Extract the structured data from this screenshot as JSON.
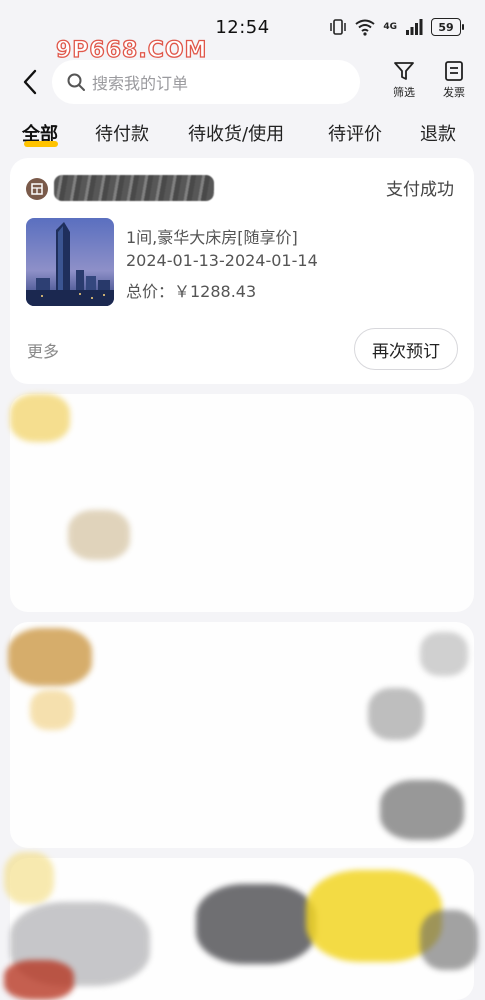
{
  "status_bar": {
    "time": "12:54",
    "battery": "59",
    "network": "4G"
  },
  "watermark": {
    "text": "9P668.COM"
  },
  "header": {
    "search_placeholder": "搜索我的订单",
    "filter_label": "筛选",
    "invoice_label": "发票"
  },
  "tabs": [
    {
      "label": "全部",
      "active": true
    },
    {
      "label": "待付款",
      "active": false
    },
    {
      "label": "待收货/使用",
      "active": false
    },
    {
      "label": "待评价",
      "active": false
    },
    {
      "label": "退款",
      "active": false
    }
  ],
  "order": {
    "status": "支付成功",
    "room": "1间,豪华大床房[随享价]",
    "dates": "2024-01-13-2024-01-14",
    "total": "总价：￥1288.43",
    "more_label": "更多",
    "rebook_label": "再次预订"
  },
  "colors": {
    "accent": "#ffc300",
    "background": "#f4f4f7",
    "watermark_stroke": "#e0574a"
  }
}
